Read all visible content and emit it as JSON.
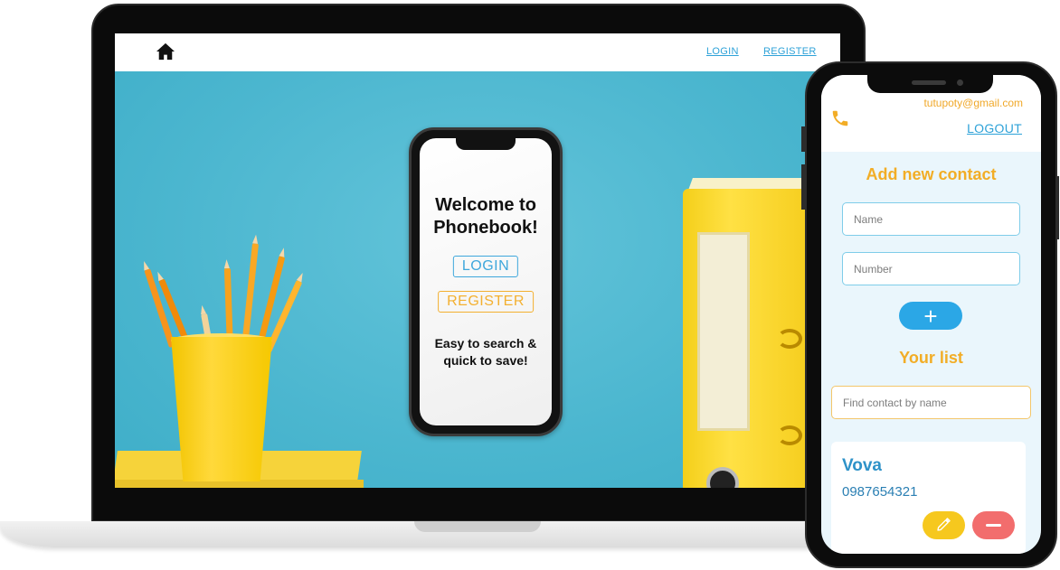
{
  "laptop": {
    "nav": {
      "login": "LOGIN",
      "register": "REGISTER"
    },
    "welcome_line1": "Welcome to",
    "welcome_line2": "Phonebook!",
    "login_button": "LOGIN",
    "register_button": "REGISTER",
    "tagline_line1": "Easy to search &",
    "tagline_line2": "quick to save!"
  },
  "phone": {
    "email": "tutupoty@gmail.com",
    "logout": "LOGOUT",
    "add_title": "Add new contact",
    "name_placeholder": "Name",
    "number_placeholder": "Number",
    "add_button": "+",
    "list_title": "Your list",
    "find_placeholder": "Find contact by name",
    "contacts": [
      {
        "name": "Vova",
        "number": "0987654321"
      }
    ]
  },
  "colors": {
    "accent_blue": "#2ea2d8",
    "accent_orange": "#f2ad26",
    "hero_bg": "#4fb7d0",
    "delete_red": "#f26d6d",
    "edit_yellow": "#f6c81e"
  },
  "icons": [
    "home-icon",
    "phone-icon",
    "plus-icon",
    "pencil-icon",
    "minus-icon"
  ]
}
